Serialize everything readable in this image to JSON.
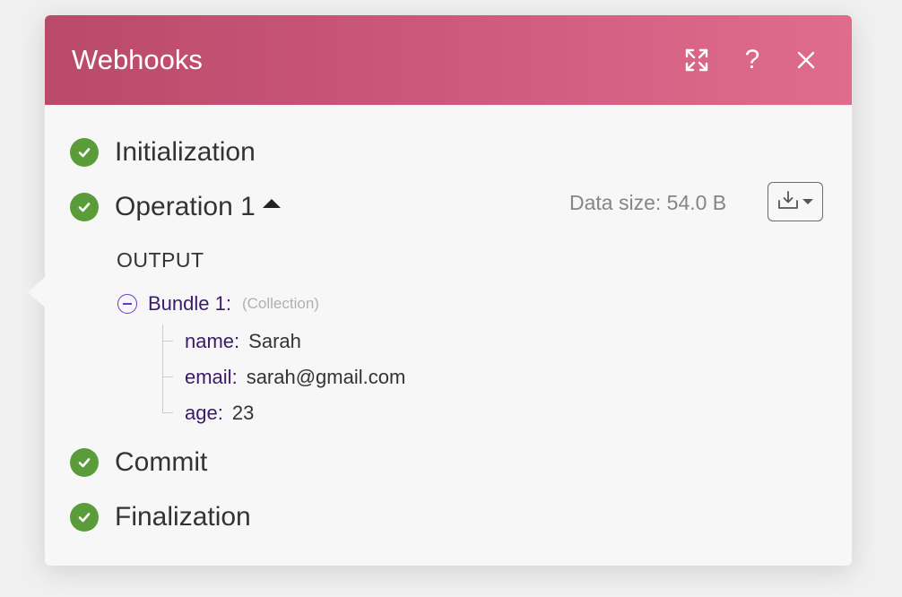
{
  "header": {
    "title": "Webhooks",
    "accent_from": "#b94a68",
    "accent_to": "#e06c8d",
    "buttons": [
      {
        "name": "expand",
        "icon": "expand-icon"
      },
      {
        "name": "help",
        "icon": "help-icon",
        "glyph": "?"
      },
      {
        "name": "close",
        "icon": "close-icon"
      }
    ]
  },
  "steps": [
    {
      "label": "Initialization",
      "status": "success"
    },
    {
      "label": "Operation 1",
      "status": "success"
    },
    {
      "label": "Commit",
      "status": "success"
    },
    {
      "label": "Finalization",
      "status": "success"
    }
  ],
  "operation": {
    "data_size": "Data size: 54.0 B",
    "output_label": "OUTPUT",
    "bundle": {
      "label": "Bundle 1:",
      "type": "(Collection)",
      "fields": [
        {
          "key": "name:",
          "value": "Sarah"
        },
        {
          "key": "email:",
          "value": "sarah@gmail.com"
        },
        {
          "key": "age:",
          "value": "23"
        }
      ]
    }
  },
  "colors": {
    "success": "#5b9c3a",
    "key_text": "#3b1a6e",
    "collapse_icon": "#6b35d6"
  }
}
